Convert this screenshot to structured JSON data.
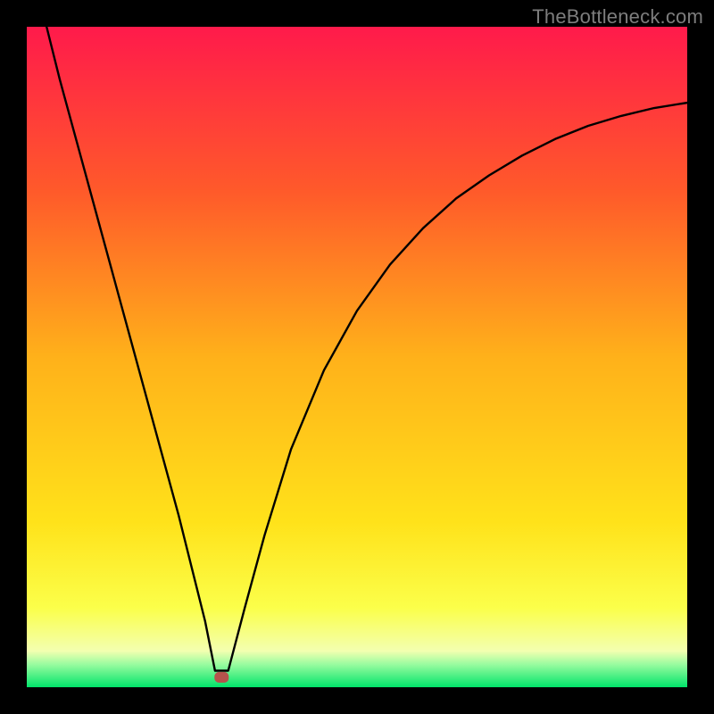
{
  "watermark": "TheBottleneck.com",
  "chart_data": {
    "type": "line",
    "title": "",
    "xlabel": "",
    "ylabel": "",
    "ylim": [
      0,
      100
    ],
    "xlim": [
      0,
      100
    ],
    "gradient_stops": [
      {
        "offset": 0.0,
        "color": "#ff1a4b"
      },
      {
        "offset": 0.25,
        "color": "#ff5a2a"
      },
      {
        "offset": 0.5,
        "color": "#ffb11a"
      },
      {
        "offset": 0.75,
        "color": "#ffe21a"
      },
      {
        "offset": 0.88,
        "color": "#fbff4a"
      },
      {
        "offset": 0.945,
        "color": "#f3ffb0"
      },
      {
        "offset": 0.965,
        "color": "#9bfca0"
      },
      {
        "offset": 1.0,
        "color": "#00e46a"
      }
    ],
    "optimal_point": {
      "x": 29.5,
      "y": 1.5,
      "color": "#b6524c"
    },
    "series": [
      {
        "name": "bottleneck-curve",
        "type": "line",
        "color": "#000000",
        "x": [
          3,
          5,
          8,
          11,
          14,
          17,
          20,
          23,
          25,
          27,
          28.5,
          30.5,
          33,
          36,
          40,
          45,
          50,
          55,
          60,
          65,
          70,
          75,
          80,
          85,
          90,
          95,
          100
        ],
        "y": [
          100,
          92,
          81,
          70,
          59,
          48,
          37,
          26,
          18,
          10,
          2.5,
          2.5,
          12,
          23,
          36,
          48,
          57,
          64,
          69.5,
          74,
          77.5,
          80.5,
          83,
          85,
          86.5,
          87.7,
          88.5
        ]
      }
    ]
  }
}
